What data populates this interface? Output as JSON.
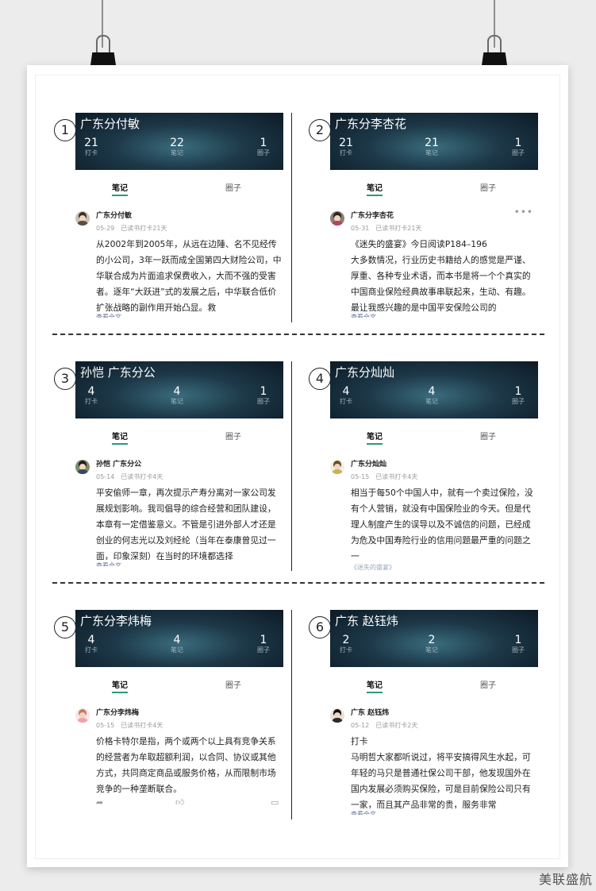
{
  "stats_labels": {
    "checkin": "打卡",
    "notes": "笔记",
    "circles": "圈子"
  },
  "tabs": {
    "notes": "笔记",
    "circle": "圈子"
  },
  "more_label": "查看全文",
  "watermark": "美联盛航",
  "cards": [
    {
      "num": "1",
      "title": "广东分付敏",
      "checkin": "21",
      "notes": "22",
      "circles": "1",
      "user": "广东分付敏",
      "date": "05-29",
      "status": "已读书打卡21天",
      "lines": [
        "从2002年到2005年，从远在边陲、名不见经传的小公司，3年一跃而成全国第四大财险公司，中华联合成为片面追求保费收入，大而不强的受害者。逐年“大跃进”式的发展之后，中华联合低价扩张战略的副作用开始凸显。救"
      ]
    },
    {
      "num": "2",
      "title": "广东分李杏花",
      "checkin": "21",
      "notes": "21",
      "circles": "1",
      "user": "广东分李杏花",
      "date": "05-31",
      "status": "已读书打卡21天",
      "lines": [
        "《迷失的盛宴》今日阅读P184–196",
        "大多数情况，行业历史书籍给人的感觉是严谨、厚重、各种专业术语，而本书是将一个个真实的中国商业保险经典故事串联起来，生动、有趣。最让我感兴趣的是中国平安保险公司的"
      ]
    },
    {
      "num": "3",
      "title": "孙恺 广东分公",
      "checkin": "4",
      "notes": "4",
      "circles": "1",
      "user": "孙恺 广东分公",
      "date": "05-14",
      "status": "已读书打卡4天",
      "lines": [
        "平安偷师一章，再次提示产寿分离对一家公司发展规划影响。我司倡导的综合经营和团队建设，本章有一定借鉴意义。不管是引进外部人才还是创业的何志光以及刘经纶（当年在泰康曾见过一面，印象深刻）在当时的环境都选择"
      ]
    },
    {
      "num": "4",
      "title": "广东分灿灿",
      "checkin": "4",
      "notes": "4",
      "circles": "1",
      "user": "广东分灿灿",
      "date": "05-15",
      "status": "已读书打卡4天",
      "lines": [
        "相当于每50个中国人中，就有一个卖过保险，没有个人营销，就没有中国保险业的今天。但是代理人制度产生的误导以及不诚信的问题，已经成为危及中国寿险行业的信用问题最严重的问题之一"
      ],
      "book_ref": "《迷失的盛宴》"
    },
    {
      "num": "5",
      "title": "广东分李炜梅",
      "checkin": "4",
      "notes": "4",
      "circles": "1",
      "user": "广东分李炜梅",
      "date": "05-15",
      "status": "已读书打卡4天",
      "lines": [
        "价格卡特尔是指，两个或两个以上具有竞争关系的经营者为牟取超额利润，以合同、协议或其他方式，共同商定商品或服务价格，从而限制市场竞争的一种垄断联合。"
      ]
    },
    {
      "num": "6",
      "title": "广东 赵钰炜",
      "checkin": "2",
      "notes": "2",
      "circles": "1",
      "user": "广东 赵钰炜",
      "date": "05-12",
      "status": "已读书打卡2天",
      "lines": [
        "打卡",
        "马明哲大家都听说过，将平安搞得风生水起，可年轻的马只是普通社保公司干部，他发现国外在国内发展必须购买保险，可是目前保险公司只有一家，而且其产品非常的贵，服务非常"
      ]
    }
  ]
}
